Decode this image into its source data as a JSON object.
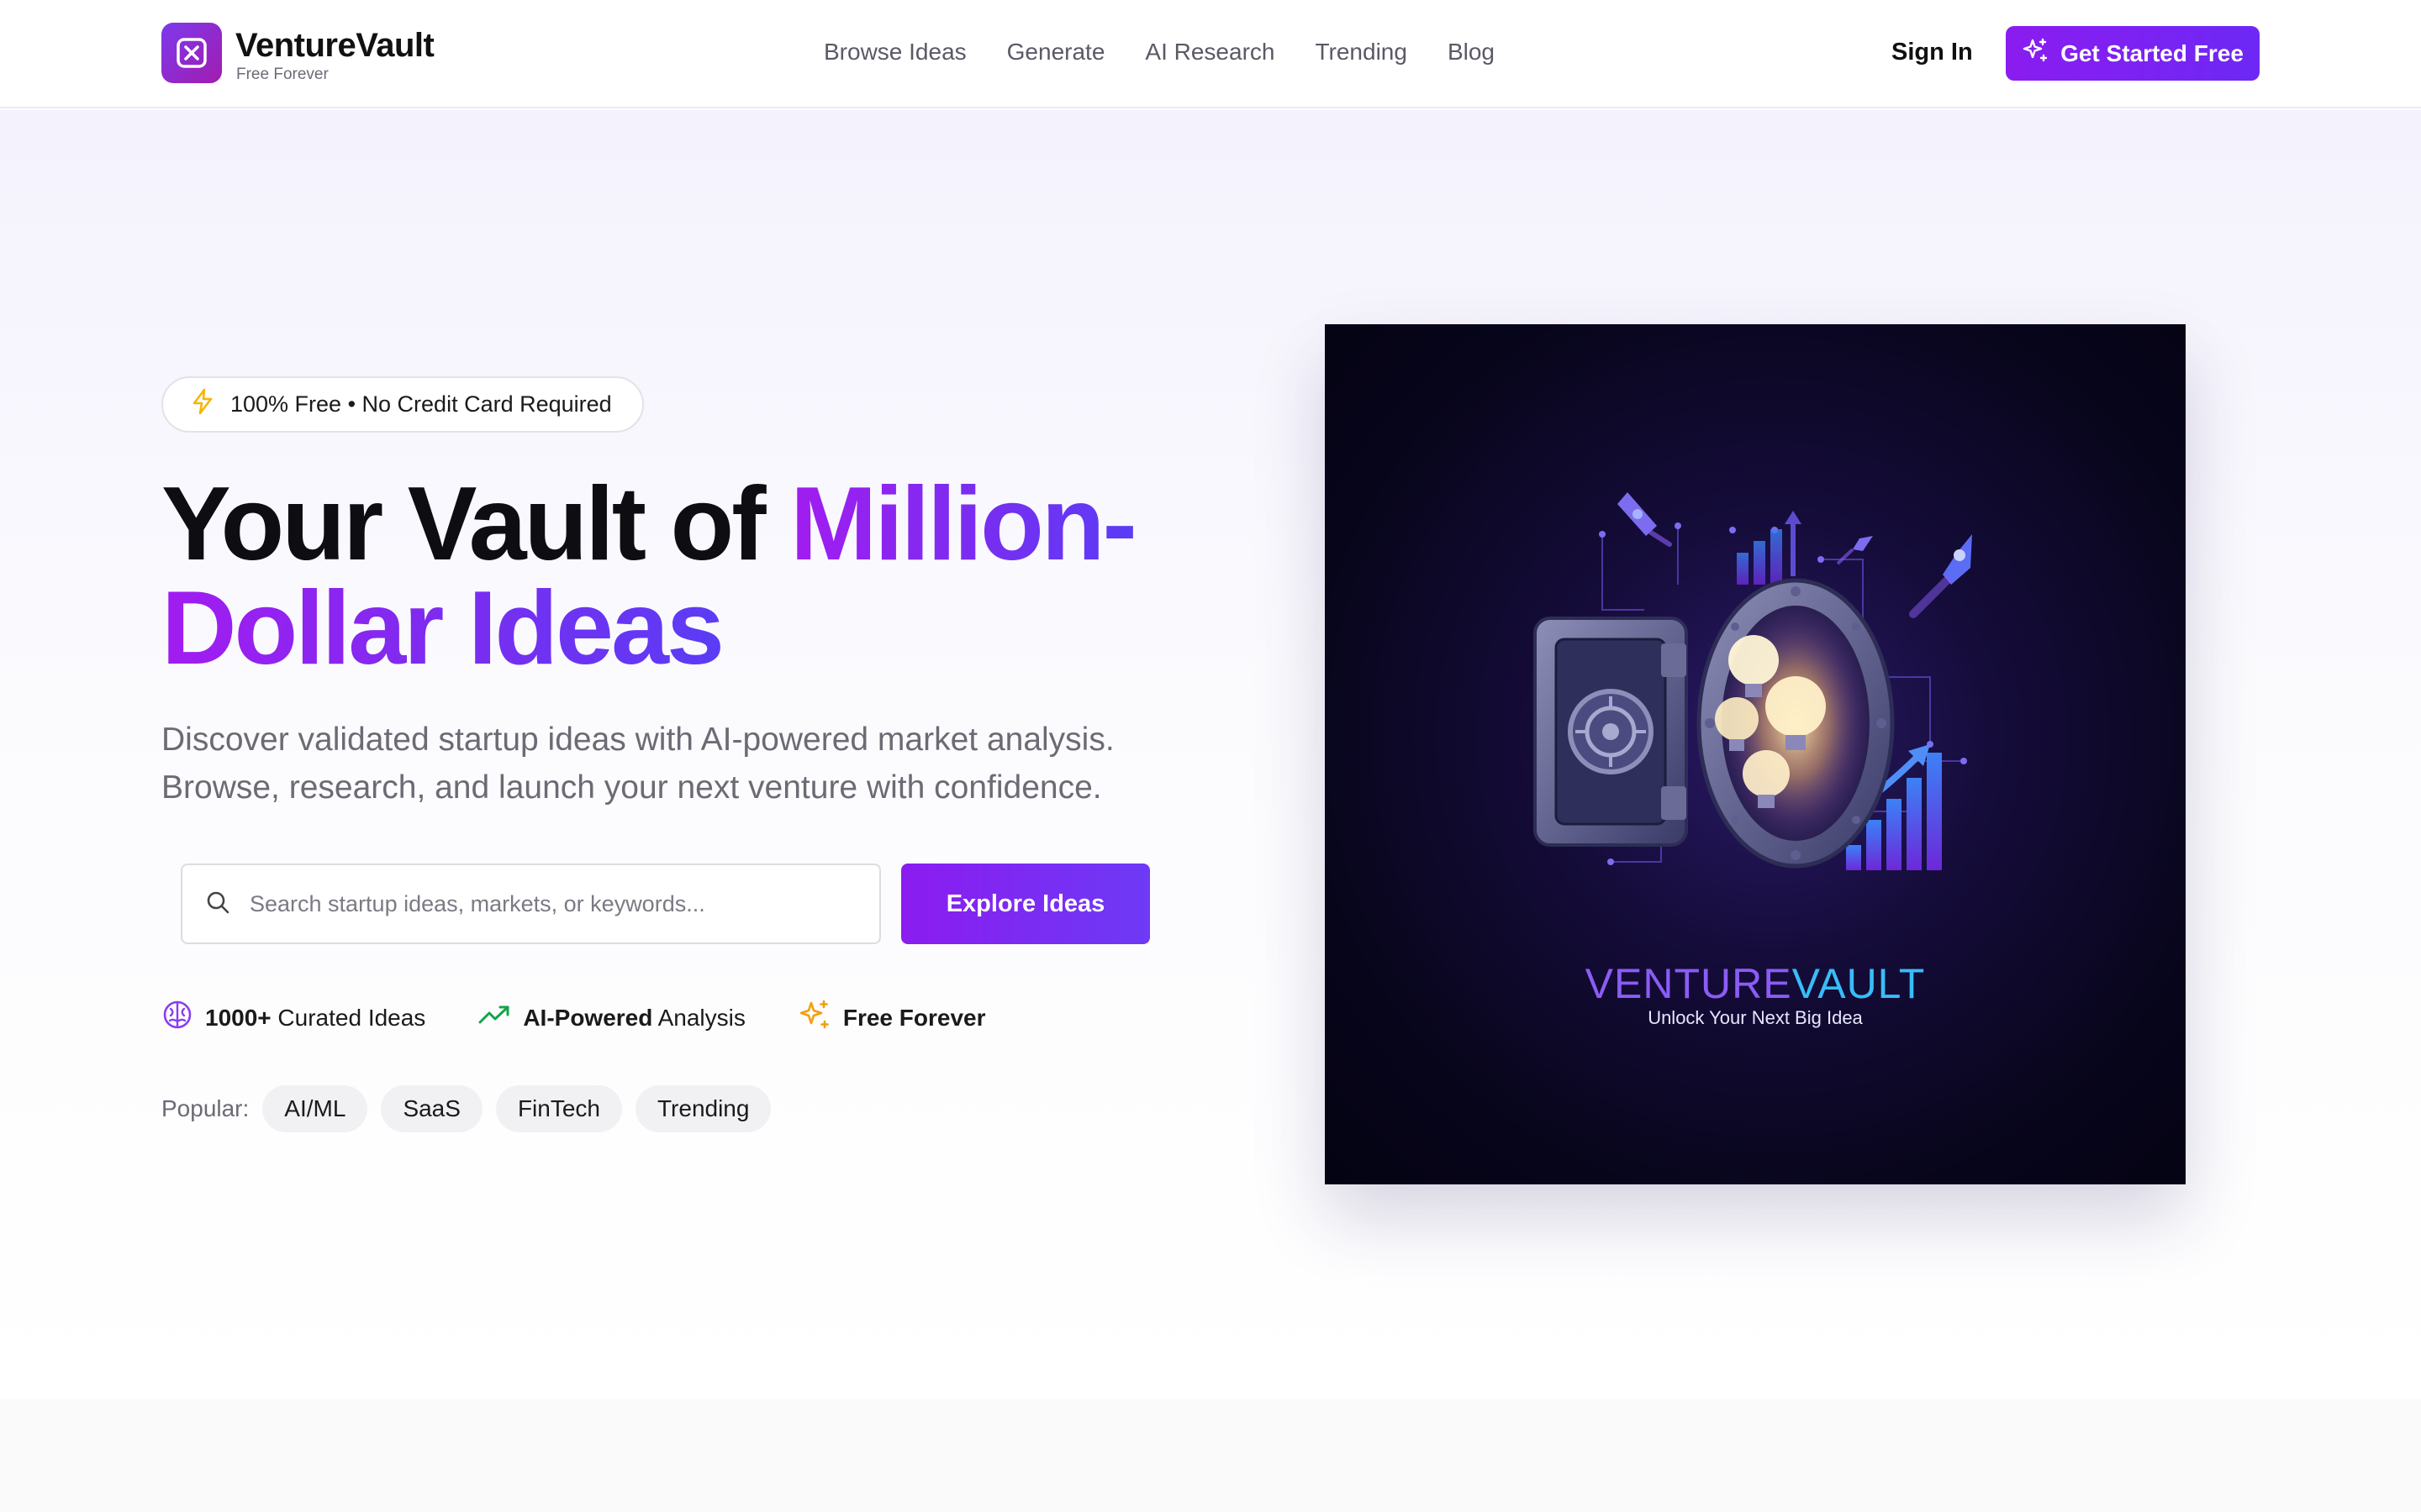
{
  "header": {
    "brand_name": "VentureVault",
    "brand_sub": "Free Forever",
    "nav": [
      "Browse Ideas",
      "Generate",
      "AI Research",
      "Trending",
      "Blog"
    ],
    "sign_in": "Sign In",
    "cta": "Get Started Free"
  },
  "hero": {
    "badge": "100% Free • No Credit Card Required",
    "headline_plain": "Your Vault of ",
    "headline_gradient_1": "Million-",
    "headline_gradient_2": "Dollar Ideas",
    "subtext_line1": "Discover validated startup ideas with AI-powered market analysis.",
    "subtext_line2": "Browse, research, and launch your next venture with confidence.",
    "search_placeholder": "Search startup ideas, markets, or keywords...",
    "explore_button": "Explore Ideas",
    "features": [
      {
        "bold": "1000+",
        "rest": "Curated Ideas",
        "icon": "brain-icon"
      },
      {
        "bold": "AI-Powered",
        "rest": "Analysis",
        "icon": "trending-up-icon"
      },
      {
        "bold": "Free Forever",
        "rest": "",
        "icon": "sparkles-icon"
      }
    ],
    "popular_label": "Popular:",
    "popular_tags": [
      "AI/ML",
      "SaaS",
      "FinTech",
      "Trending"
    ]
  },
  "illustration": {
    "title_part1": "VENTURE",
    "title_part2": "VAULT",
    "subtitle": "Unlock Your Next Big Idea"
  },
  "colors": {
    "accent": "#7c3aed",
    "gradient_start": "#a21cf0",
    "gradient_end": "#5b3cf5",
    "badge_bolt": "#f5b50a",
    "trend_green": "#16a34a",
    "sparkle_amber": "#f59e0b"
  }
}
